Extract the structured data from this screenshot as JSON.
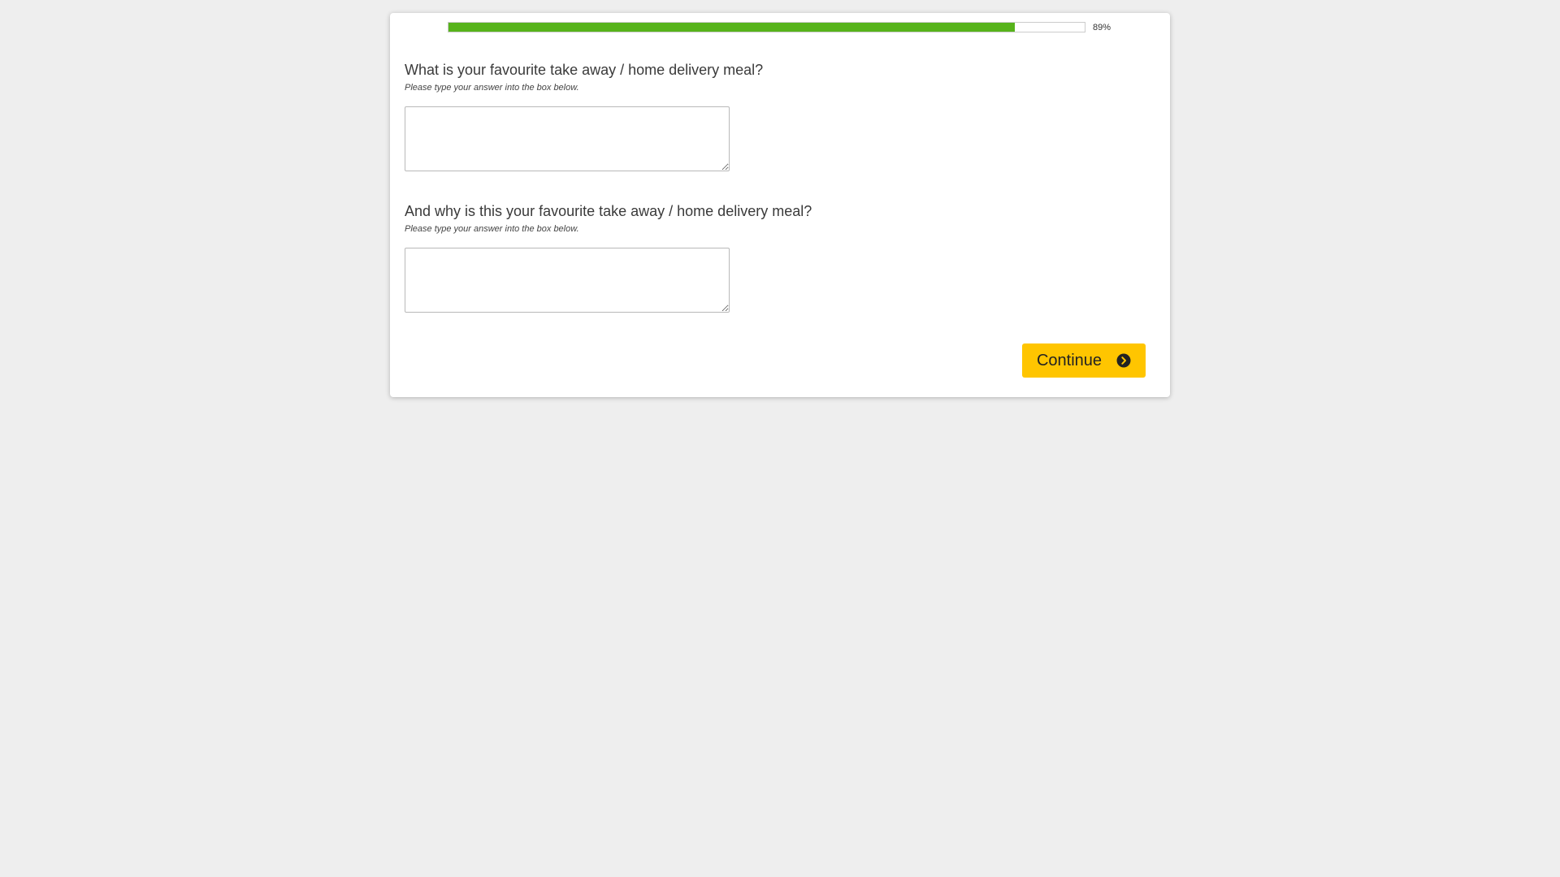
{
  "progress": {
    "percent": 89,
    "label": "89%",
    "fill_color": "#57b31b"
  },
  "questions": [
    {
      "title": "What is your favourite take away / home delivery meal?",
      "hint": "Please type your answer into the box below.",
      "answer_value": ""
    },
    {
      "title": "And why is this your favourite take away / home delivery meal?",
      "hint": "Please type your answer into the box below.",
      "answer_value": ""
    }
  ],
  "continue_button": {
    "label": "Continue",
    "icon": "chevron-right-circle-icon",
    "color": "#ffc500"
  }
}
